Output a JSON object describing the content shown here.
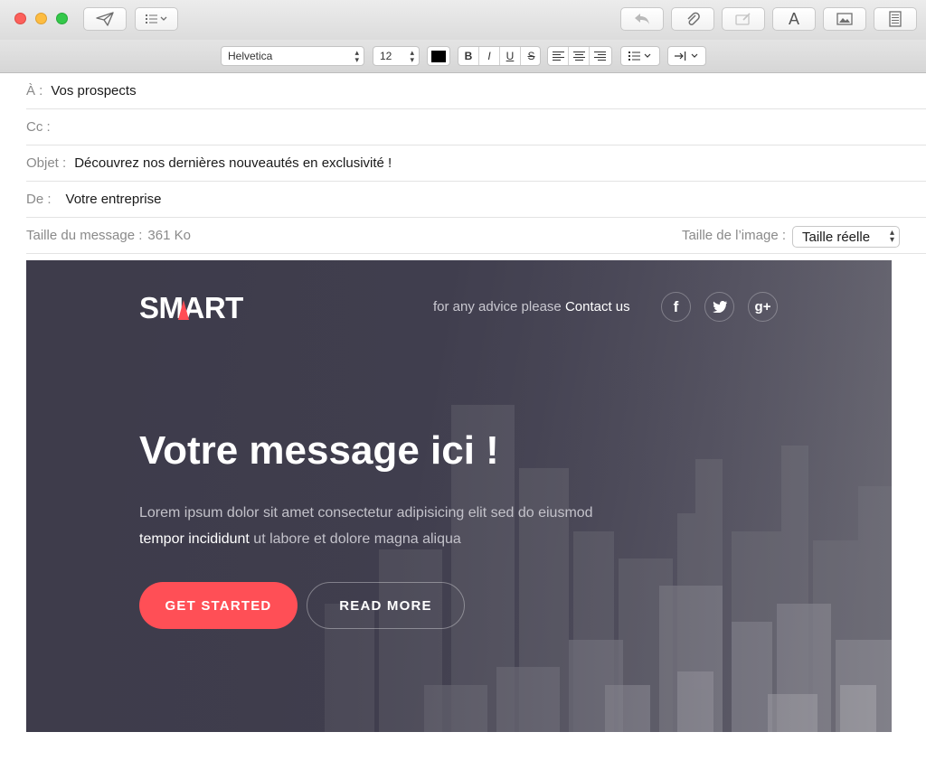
{
  "toolbar": {
    "icons": [
      "send-icon",
      "header-fields-menu-icon",
      "reply-icon",
      "attachment-icon",
      "markup-icon",
      "font-icon",
      "photo-browser-icon",
      "stationery-icon"
    ],
    "font_button_label": "A"
  },
  "format_bar": {
    "font_family": "Helvetica",
    "font_size": "12",
    "text_color": "#000000",
    "bold": "B",
    "italic": "I",
    "underline": "U",
    "strike": "S"
  },
  "header": {
    "to_label": "À :",
    "to_value": "Vos prospects",
    "cc_label": "Cc :",
    "cc_value": "",
    "subject_label": "Objet :",
    "subject_value": "Découvrez nos dernières nouveautés en exclusivité !",
    "from_label": "De :",
    "from_value": "Votre entreprise",
    "message_size_label": "Taille du message :",
    "message_size_value": "361 Ko",
    "image_size_label": "Taille de l’image :",
    "image_size_value": "Taille réelle"
  },
  "email": {
    "logo": "SMART",
    "advice_text": "for any advice please",
    "contact_link": "Contact us",
    "social": [
      "facebook-icon",
      "twitter-icon",
      "google-plus-icon"
    ],
    "facebook_glyph": "f",
    "google_plus_glyph": "g+",
    "headline": "Votre message ici !",
    "body_line1": "Lorem ipsum dolor sit amet consectetur adipisicing elit sed do eiusmod",
    "body_line2_highlight": "tempor incididunt",
    "body_line2_rest": " ut labore et dolore magna aliqua",
    "primary_button": "GET STARTED",
    "secondary_button": "READ MORE",
    "accent_color": "#ff4f56"
  }
}
